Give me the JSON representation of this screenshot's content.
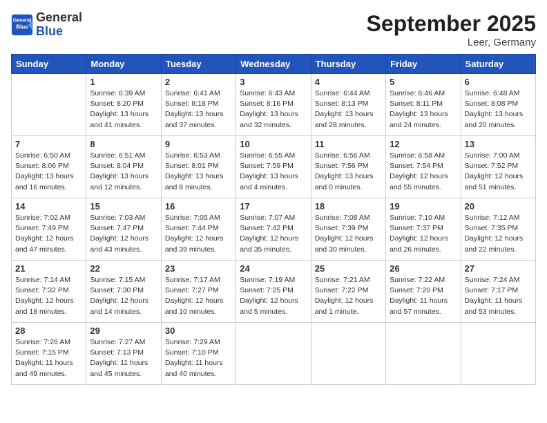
{
  "header": {
    "logo_line1": "General",
    "logo_line2": "Blue",
    "month": "September 2025",
    "location": "Leer, Germany"
  },
  "weekdays": [
    "Sunday",
    "Monday",
    "Tuesday",
    "Wednesday",
    "Thursday",
    "Friday",
    "Saturday"
  ],
  "weeks": [
    [
      {
        "day": "",
        "info": ""
      },
      {
        "day": "1",
        "info": "Sunrise: 6:39 AM\nSunset: 8:20 PM\nDaylight: 13 hours\nand 41 minutes."
      },
      {
        "day": "2",
        "info": "Sunrise: 6:41 AM\nSunset: 8:18 PM\nDaylight: 13 hours\nand 37 minutes."
      },
      {
        "day": "3",
        "info": "Sunrise: 6:43 AM\nSunset: 8:16 PM\nDaylight: 13 hours\nand 32 minutes."
      },
      {
        "day": "4",
        "info": "Sunrise: 6:44 AM\nSunset: 8:13 PM\nDaylight: 13 hours\nand 28 minutes."
      },
      {
        "day": "5",
        "info": "Sunrise: 6:46 AM\nSunset: 8:11 PM\nDaylight: 13 hours\nand 24 minutes."
      },
      {
        "day": "6",
        "info": "Sunrise: 6:48 AM\nSunset: 8:08 PM\nDaylight: 13 hours\nand 20 minutes."
      }
    ],
    [
      {
        "day": "7",
        "info": "Sunrise: 6:50 AM\nSunset: 8:06 PM\nDaylight: 13 hours\nand 16 minutes."
      },
      {
        "day": "8",
        "info": "Sunrise: 6:51 AM\nSunset: 8:04 PM\nDaylight: 13 hours\nand 12 minutes."
      },
      {
        "day": "9",
        "info": "Sunrise: 6:53 AM\nSunset: 8:01 PM\nDaylight: 13 hours\nand 8 minutes."
      },
      {
        "day": "10",
        "info": "Sunrise: 6:55 AM\nSunset: 7:59 PM\nDaylight: 13 hours\nand 4 minutes."
      },
      {
        "day": "11",
        "info": "Sunrise: 6:56 AM\nSunset: 7:56 PM\nDaylight: 13 hours\nand 0 minutes."
      },
      {
        "day": "12",
        "info": "Sunrise: 6:58 AM\nSunset: 7:54 PM\nDaylight: 12 hours\nand 55 minutes."
      },
      {
        "day": "13",
        "info": "Sunrise: 7:00 AM\nSunset: 7:52 PM\nDaylight: 12 hours\nand 51 minutes."
      }
    ],
    [
      {
        "day": "14",
        "info": "Sunrise: 7:02 AM\nSunset: 7:49 PM\nDaylight: 12 hours\nand 47 minutes."
      },
      {
        "day": "15",
        "info": "Sunrise: 7:03 AM\nSunset: 7:47 PM\nDaylight: 12 hours\nand 43 minutes."
      },
      {
        "day": "16",
        "info": "Sunrise: 7:05 AM\nSunset: 7:44 PM\nDaylight: 12 hours\nand 39 minutes."
      },
      {
        "day": "17",
        "info": "Sunrise: 7:07 AM\nSunset: 7:42 PM\nDaylight: 12 hours\nand 35 minutes."
      },
      {
        "day": "18",
        "info": "Sunrise: 7:08 AM\nSunset: 7:39 PM\nDaylight: 12 hours\nand 30 minutes."
      },
      {
        "day": "19",
        "info": "Sunrise: 7:10 AM\nSunset: 7:37 PM\nDaylight: 12 hours\nand 26 minutes."
      },
      {
        "day": "20",
        "info": "Sunrise: 7:12 AM\nSunset: 7:35 PM\nDaylight: 12 hours\nand 22 minutes."
      }
    ],
    [
      {
        "day": "21",
        "info": "Sunrise: 7:14 AM\nSunset: 7:32 PM\nDaylight: 12 hours\nand 18 minutes."
      },
      {
        "day": "22",
        "info": "Sunrise: 7:15 AM\nSunset: 7:30 PM\nDaylight: 12 hours\nand 14 minutes."
      },
      {
        "day": "23",
        "info": "Sunrise: 7:17 AM\nSunset: 7:27 PM\nDaylight: 12 hours\nand 10 minutes."
      },
      {
        "day": "24",
        "info": "Sunrise: 7:19 AM\nSunset: 7:25 PM\nDaylight: 12 hours\nand 5 minutes."
      },
      {
        "day": "25",
        "info": "Sunrise: 7:21 AM\nSunset: 7:22 PM\nDaylight: 12 hours\nand 1 minute."
      },
      {
        "day": "26",
        "info": "Sunrise: 7:22 AM\nSunset: 7:20 PM\nDaylight: 11 hours\nand 57 minutes."
      },
      {
        "day": "27",
        "info": "Sunrise: 7:24 AM\nSunset: 7:17 PM\nDaylight: 11 hours\nand 53 minutes."
      }
    ],
    [
      {
        "day": "28",
        "info": "Sunrise: 7:26 AM\nSunset: 7:15 PM\nDaylight: 11 hours\nand 49 minutes."
      },
      {
        "day": "29",
        "info": "Sunrise: 7:27 AM\nSunset: 7:13 PM\nDaylight: 11 hours\nand 45 minutes."
      },
      {
        "day": "30",
        "info": "Sunrise: 7:29 AM\nSunset: 7:10 PM\nDaylight: 11 hours\nand 40 minutes."
      },
      {
        "day": "",
        "info": ""
      },
      {
        "day": "",
        "info": ""
      },
      {
        "day": "",
        "info": ""
      },
      {
        "day": "",
        "info": ""
      }
    ]
  ]
}
